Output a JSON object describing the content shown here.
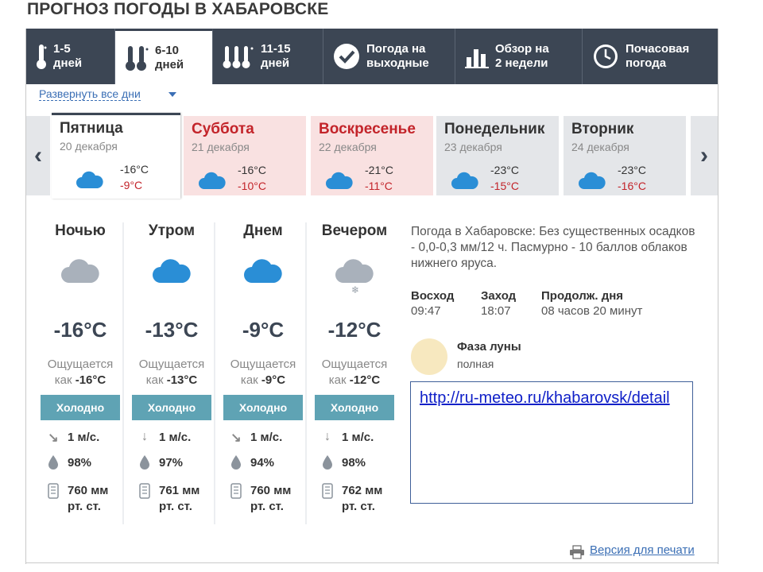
{
  "page_title": "ПРОГНОЗ ПОГОДЫ В ХАБАРОВСКЕ",
  "nav_tabs": [
    {
      "label": "1-5\nдней",
      "icon": "thermometer-icon"
    },
    {
      "label": "6-10\nдней",
      "icon": "two-thermometers-icon",
      "active": true
    },
    {
      "label": "11-15\nдней",
      "icon": "three-thermometers-icon"
    },
    {
      "label": "Погода на\nвыходные",
      "icon": "check-circle-icon"
    },
    {
      "label": "Обзор на\n2 недели",
      "icon": "bar-chart-icon"
    },
    {
      "label": "Почасовая\nпогода",
      "icon": "clock-icon"
    }
  ],
  "expand_all_label": "Развернуть все дни",
  "days": [
    {
      "name": "Пятница",
      "date": "20 декабря",
      "min": "-16°C",
      "max": "-9°C"
    },
    {
      "name": "Суббота",
      "date": "21 декабря",
      "min": "-16°C",
      "max": "-10°C"
    },
    {
      "name": "Воскресенье",
      "date": "22 декабря",
      "min": "-21°C",
      "max": "-11°C"
    },
    {
      "name": "Понедельник",
      "date": "23 декабря",
      "min": "-23°C",
      "max": "-15°C"
    },
    {
      "name": "Вторник",
      "date": "24 декабря",
      "min": "-23°C",
      "max": "-16°C"
    }
  ],
  "nav_arrows": {
    "prev": "‹",
    "next": "›"
  },
  "parts": [
    {
      "name": "Ночью",
      "temp": "-16°C",
      "feels_prefix": "Ощущается",
      "feels_as": "как",
      "feels_value": "-16°C",
      "comfort": "Холодно",
      "wind": "1 м/с.",
      "humidity": "98%",
      "pressure_line1": "760 мм",
      "pressure_line2": "рт. ст."
    },
    {
      "name": "Утром",
      "temp": "-13°C",
      "feels_prefix": "Ощущается",
      "feels_as": "как",
      "feels_value": "-13°C",
      "comfort": "Холодно",
      "wind": "1 м/с.",
      "humidity": "97%",
      "pressure_line1": "761 мм",
      "pressure_line2": "рт. ст."
    },
    {
      "name": "Днем",
      "temp": "-9°C",
      "feels_prefix": "Ощущается",
      "feels_as": "как",
      "feels_value": "-9°C",
      "comfort": "Холодно",
      "wind": "1 м/с.",
      "humidity": "94%",
      "pressure_line1": "760 мм",
      "pressure_line2": "рт. ст."
    },
    {
      "name": "Вечером",
      "temp": "-12°C",
      "feels_prefix": "Ощущается",
      "feels_as": "как",
      "feels_value": "-12°C",
      "comfort": "Холодно",
      "wind": "1 м/с.",
      "humidity": "98%",
      "pressure_line1": "762 мм",
      "pressure_line2": "рт. ст."
    }
  ],
  "description": "Погода в Хабаровске: Без существенных осадков - 0,0-0,3 мм/12 ч. Пасмурно - 10 баллов облаков нижнего яруса.",
  "sun": {
    "sunrise_label": "Восход",
    "sunrise": "09:47",
    "sunset_label": "Заход",
    "sunset": "18:07",
    "daylen_label": "Продолж. дня",
    "daylen": "08 часов 20 минут"
  },
  "moon": {
    "label": "Фаза луны",
    "value": "полная"
  },
  "link": "http://ru-meteo.ru/khabarovsk/detail",
  "print_label": "Версия для печати",
  "colors": {
    "nav_bg": "#3c4654",
    "weekend_bg": "#f9e1e1",
    "weekday_bg": "#e4e6e9",
    "accent_red": "#c3242a",
    "comfort_bg": "#5fa3b4",
    "cloud_blue": "#2a8ed6",
    "cloud_gray": "#a9b1bb"
  }
}
